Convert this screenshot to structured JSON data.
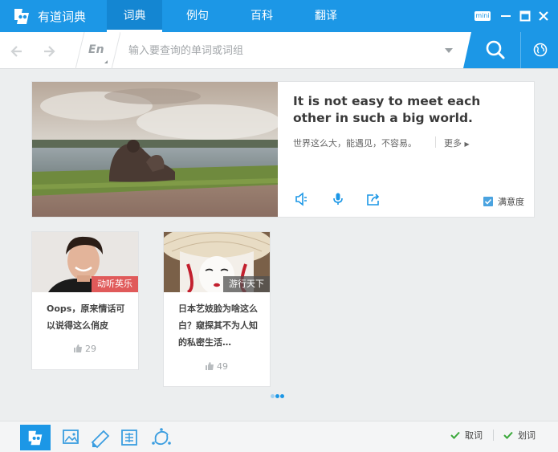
{
  "app": {
    "name": "有道词典",
    "logo_icon": "youdao-logo-icon"
  },
  "nav": {
    "tabs": [
      "词典",
      "例句",
      "百科",
      "翻译"
    ],
    "active": 0
  },
  "window": {
    "mini_label": "mini"
  },
  "search": {
    "lang": "En",
    "placeholder": "输入要查询的单词或词组",
    "value": ""
  },
  "daily": {
    "sentence": "It is not easy to meet each other in such a big world.",
    "translation": "世界这么大，能遇见，不容易。",
    "more": "更多",
    "satisfaction_label": "满意度",
    "satisfaction_checked": true
  },
  "articles": [
    {
      "tag": "动听英乐",
      "title": "Oops，原来情话可以说得这么俏皮",
      "likes": "29",
      "tag_color": "#e05a5a"
    },
    {
      "tag": "游行天下",
      "title": "日本艺妓脸为啥这么白？窥探其不为人知的私密生活…",
      "likes": "49",
      "tag_color": "#6b6b6b"
    }
  ],
  "pager": {
    "count": 3,
    "active": 1
  },
  "bottom": {
    "tools": [
      "dict-tool-icon",
      "image-translate-icon",
      "note-icon",
      "translate-tool-icon",
      "sync-icon"
    ],
    "toggles": [
      {
        "label": "取词",
        "checked": true
      },
      {
        "label": "划词",
        "checked": true
      }
    ]
  },
  "colors": {
    "brand": "#1c97e6",
    "brand_dark": "#1486d2",
    "check": "#3aa83a"
  }
}
